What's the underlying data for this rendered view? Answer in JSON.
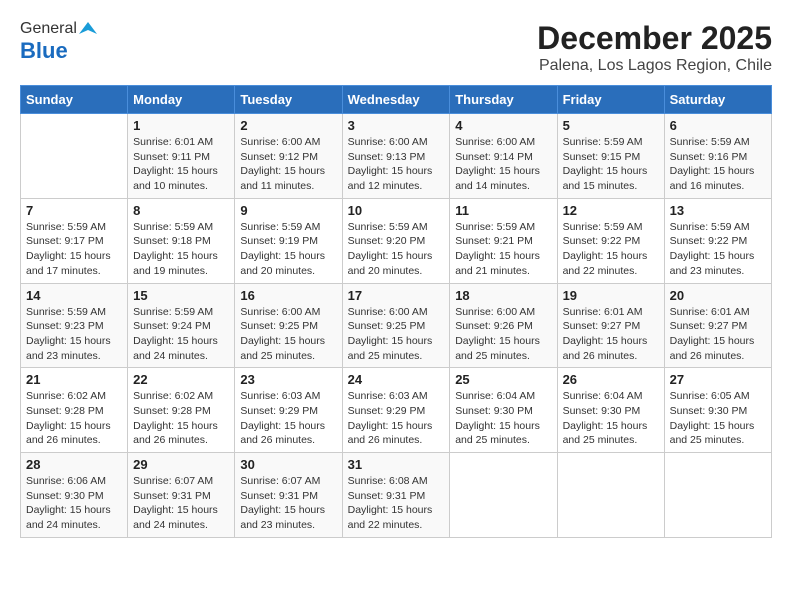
{
  "header": {
    "logo_line1": "General",
    "logo_line2": "Blue",
    "title": "December 2025",
    "subtitle": "Palena, Los Lagos Region, Chile"
  },
  "days_of_week": [
    "Sunday",
    "Monday",
    "Tuesday",
    "Wednesday",
    "Thursday",
    "Friday",
    "Saturday"
  ],
  "weeks": [
    [
      {
        "num": "",
        "info": ""
      },
      {
        "num": "1",
        "info": "Sunrise: 6:01 AM\nSunset: 9:11 PM\nDaylight: 15 hours\nand 10 minutes."
      },
      {
        "num": "2",
        "info": "Sunrise: 6:00 AM\nSunset: 9:12 PM\nDaylight: 15 hours\nand 11 minutes."
      },
      {
        "num": "3",
        "info": "Sunrise: 6:00 AM\nSunset: 9:13 PM\nDaylight: 15 hours\nand 12 minutes."
      },
      {
        "num": "4",
        "info": "Sunrise: 6:00 AM\nSunset: 9:14 PM\nDaylight: 15 hours\nand 14 minutes."
      },
      {
        "num": "5",
        "info": "Sunrise: 5:59 AM\nSunset: 9:15 PM\nDaylight: 15 hours\nand 15 minutes."
      },
      {
        "num": "6",
        "info": "Sunrise: 5:59 AM\nSunset: 9:16 PM\nDaylight: 15 hours\nand 16 minutes."
      }
    ],
    [
      {
        "num": "7",
        "info": "Sunrise: 5:59 AM\nSunset: 9:17 PM\nDaylight: 15 hours\nand 17 minutes."
      },
      {
        "num": "8",
        "info": "Sunrise: 5:59 AM\nSunset: 9:18 PM\nDaylight: 15 hours\nand 19 minutes."
      },
      {
        "num": "9",
        "info": "Sunrise: 5:59 AM\nSunset: 9:19 PM\nDaylight: 15 hours\nand 20 minutes."
      },
      {
        "num": "10",
        "info": "Sunrise: 5:59 AM\nSunset: 9:20 PM\nDaylight: 15 hours\nand 20 minutes."
      },
      {
        "num": "11",
        "info": "Sunrise: 5:59 AM\nSunset: 9:21 PM\nDaylight: 15 hours\nand 21 minutes."
      },
      {
        "num": "12",
        "info": "Sunrise: 5:59 AM\nSunset: 9:22 PM\nDaylight: 15 hours\nand 22 minutes."
      },
      {
        "num": "13",
        "info": "Sunrise: 5:59 AM\nSunset: 9:22 PM\nDaylight: 15 hours\nand 23 minutes."
      }
    ],
    [
      {
        "num": "14",
        "info": "Sunrise: 5:59 AM\nSunset: 9:23 PM\nDaylight: 15 hours\nand 23 minutes."
      },
      {
        "num": "15",
        "info": "Sunrise: 5:59 AM\nSunset: 9:24 PM\nDaylight: 15 hours\nand 24 minutes."
      },
      {
        "num": "16",
        "info": "Sunrise: 6:00 AM\nSunset: 9:25 PM\nDaylight: 15 hours\nand 25 minutes."
      },
      {
        "num": "17",
        "info": "Sunrise: 6:00 AM\nSunset: 9:25 PM\nDaylight: 15 hours\nand 25 minutes."
      },
      {
        "num": "18",
        "info": "Sunrise: 6:00 AM\nSunset: 9:26 PM\nDaylight: 15 hours\nand 25 minutes."
      },
      {
        "num": "19",
        "info": "Sunrise: 6:01 AM\nSunset: 9:27 PM\nDaylight: 15 hours\nand 26 minutes."
      },
      {
        "num": "20",
        "info": "Sunrise: 6:01 AM\nSunset: 9:27 PM\nDaylight: 15 hours\nand 26 minutes."
      }
    ],
    [
      {
        "num": "21",
        "info": "Sunrise: 6:02 AM\nSunset: 9:28 PM\nDaylight: 15 hours\nand 26 minutes."
      },
      {
        "num": "22",
        "info": "Sunrise: 6:02 AM\nSunset: 9:28 PM\nDaylight: 15 hours\nand 26 minutes."
      },
      {
        "num": "23",
        "info": "Sunrise: 6:03 AM\nSunset: 9:29 PM\nDaylight: 15 hours\nand 26 minutes."
      },
      {
        "num": "24",
        "info": "Sunrise: 6:03 AM\nSunset: 9:29 PM\nDaylight: 15 hours\nand 26 minutes."
      },
      {
        "num": "25",
        "info": "Sunrise: 6:04 AM\nSunset: 9:30 PM\nDaylight: 15 hours\nand 25 minutes."
      },
      {
        "num": "26",
        "info": "Sunrise: 6:04 AM\nSunset: 9:30 PM\nDaylight: 15 hours\nand 25 minutes."
      },
      {
        "num": "27",
        "info": "Sunrise: 6:05 AM\nSunset: 9:30 PM\nDaylight: 15 hours\nand 25 minutes."
      }
    ],
    [
      {
        "num": "28",
        "info": "Sunrise: 6:06 AM\nSunset: 9:30 PM\nDaylight: 15 hours\nand 24 minutes."
      },
      {
        "num": "29",
        "info": "Sunrise: 6:07 AM\nSunset: 9:31 PM\nDaylight: 15 hours\nand 24 minutes."
      },
      {
        "num": "30",
        "info": "Sunrise: 6:07 AM\nSunset: 9:31 PM\nDaylight: 15 hours\nand 23 minutes."
      },
      {
        "num": "31",
        "info": "Sunrise: 6:08 AM\nSunset: 9:31 PM\nDaylight: 15 hours\nand 22 minutes."
      },
      {
        "num": "",
        "info": ""
      },
      {
        "num": "",
        "info": ""
      },
      {
        "num": "",
        "info": ""
      }
    ]
  ]
}
